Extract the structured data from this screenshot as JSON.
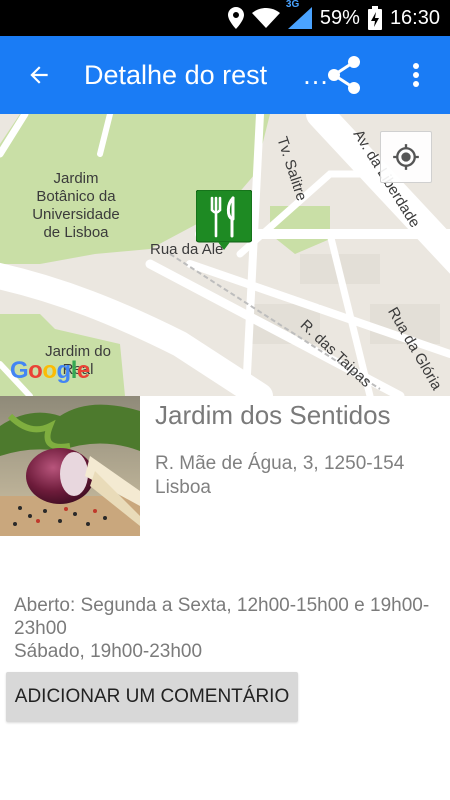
{
  "status_bar": {
    "network": "3G",
    "battery": "59%",
    "time": "16:30"
  },
  "app_bar": {
    "title": "Detalhe do rest",
    "title_ellipsis": "…",
    "back_icon": "arrow-back-icon",
    "share_icon": "share-icon",
    "menu_icon": "more-vert-icon",
    "color": "#1a7cf5"
  },
  "map": {
    "labels": {
      "garden": "Jardim Botânico da Universidade de Lisboa",
      "rua_alegria": "Rua da Ale",
      "tv_salitre": "Tv. Salitre",
      "av_liberdade": "Av. da Liberdade",
      "r_taipas": "R. das Taipas",
      "rua_gloria": "Rua da Glória",
      "jardim_principe": "Jardim do Real"
    },
    "google_logo": "Google",
    "marker_icon": "restaurant-icon",
    "locate_icon": "my-location-icon"
  },
  "restaurant": {
    "name": "Jardim dos Sentidos",
    "address": "R. Mãe de Água, 3, 1250-154 Lisboa",
    "hours_line1": "Aberto: Segunda a Sexta, 12h00-15h00 e 19h00-23h00",
    "hours_line2": "Sábado, 19h00-23h00"
  },
  "actions": {
    "add_comment": "ADICIONAR UM COMENTÁRIO"
  }
}
